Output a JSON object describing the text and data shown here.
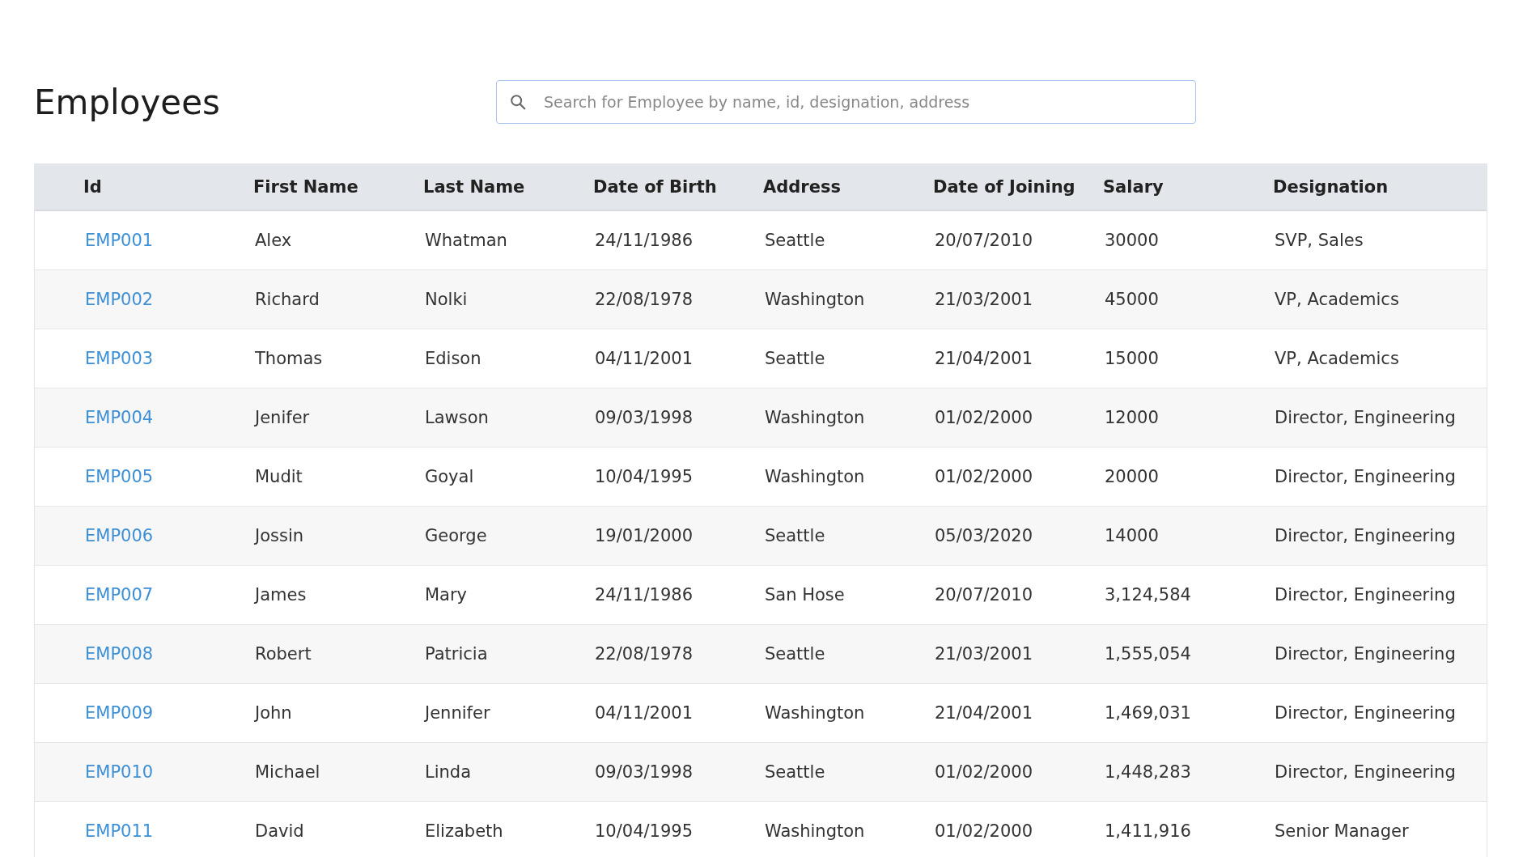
{
  "title": "Employees",
  "search": {
    "placeholder": "Search for Employee by name, id, designation, address"
  },
  "table": {
    "columns": [
      "Id",
      "First Name",
      "Last Name",
      "Date of Birth",
      "Address",
      "Date of Joining",
      "Salary",
      "Designation"
    ],
    "rows": [
      [
        "EMP001",
        "Alex",
        "Whatman",
        "24/11/1986",
        "Seattle",
        "20/07/2010",
        "30000",
        "SVP, Sales"
      ],
      [
        "EMP002",
        "Richard",
        "Nolki",
        "22/08/1978",
        "Washington",
        "21/03/2001",
        "45000",
        "VP, Academics"
      ],
      [
        "EMP003",
        "Thomas",
        "Edison",
        "04/11/2001",
        "Seattle",
        "21/04/2001",
        "15000",
        "VP, Academics"
      ],
      [
        "EMP004",
        "Jenifer",
        "Lawson",
        "09/03/1998",
        "Washington",
        "01/02/2000",
        "12000",
        "Director, Engineering"
      ],
      [
        "EMP005",
        "Mudit",
        "Goyal",
        "10/04/1995",
        "Washington",
        "01/02/2000",
        "20000",
        "Director, Engineering"
      ],
      [
        "EMP006",
        "Jossin",
        "George",
        "19/01/2000",
        "Seattle",
        "05/03/2020",
        "14000",
        "Director, Engineering"
      ],
      [
        "EMP007",
        "James",
        "Mary",
        "24/11/1986",
        "San Hose",
        "20/07/2010",
        "3,124,584",
        "Director, Engineering"
      ],
      [
        "EMP008",
        "Robert",
        "Patricia",
        "22/08/1978",
        "Seattle",
        "21/03/2001",
        "1,555,054",
        "Director, Engineering"
      ],
      [
        "EMP009",
        "John",
        "Jennifer",
        "04/11/2001",
        "Washington",
        "21/04/2001",
        "1,469,031",
        "Director, Engineering"
      ],
      [
        "EMP010",
        "Michael",
        "Linda",
        "09/03/1998",
        "Seattle",
        "01/02/2000",
        "1,448,283",
        "Director, Engineering"
      ],
      [
        "EMP011",
        "David",
        "Elizabeth",
        "10/04/1995",
        "Washington",
        "01/02/2000",
        "1,411,916",
        "Senior Manager"
      ]
    ]
  }
}
